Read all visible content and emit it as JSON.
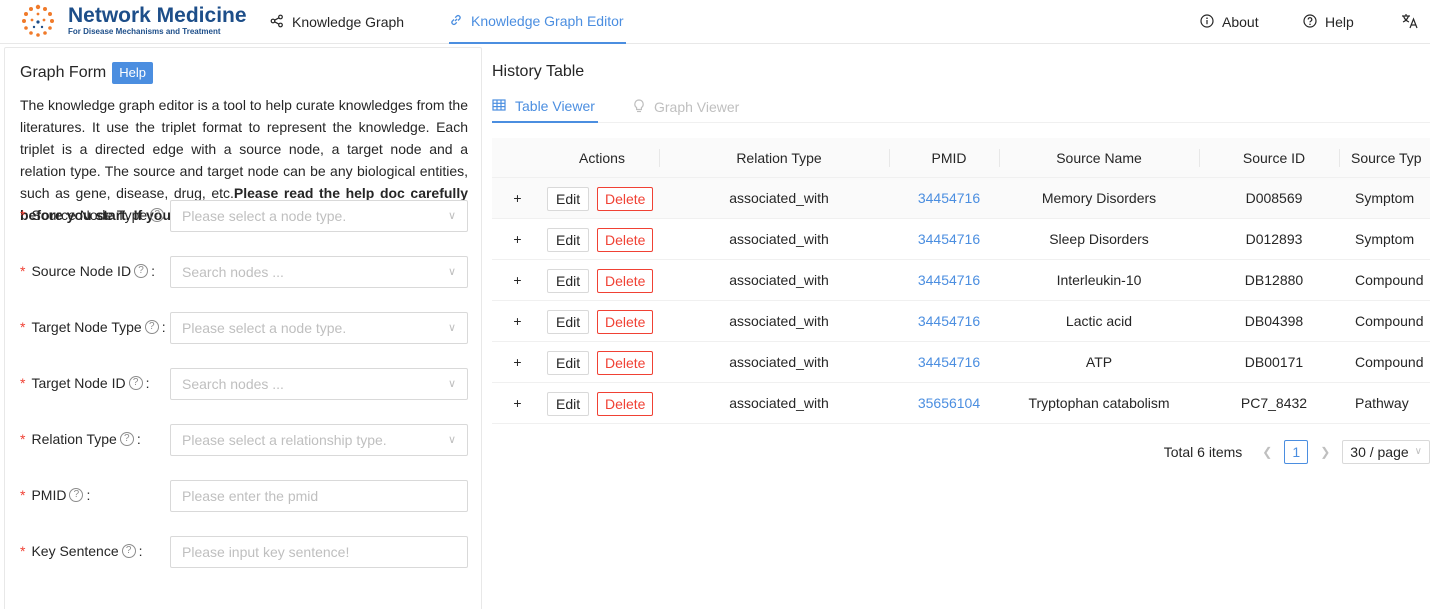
{
  "header": {
    "brand_title": "Network Medicine",
    "brand_subtitle": "For Disease Mechanisms and Treatment",
    "nav": [
      {
        "label": "Knowledge Graph",
        "icon": "share-icon"
      },
      {
        "label": "Knowledge Graph Editor",
        "icon": "link-icon",
        "active": true
      }
    ],
    "about_label": "About",
    "help_label": "Help",
    "language_icon": "translate-icon"
  },
  "form": {
    "title": "Graph Form",
    "help_button": "Help",
    "description_plain": "The knowledge graph editor is a tool to help curate knowledges from the literatures. It use the triplet format to represent the knowledge. Each triplet is a directed edge with a source node, a target node and a relation type. The source and target node can be any biological entities, such as gene, disease, drug, etc.",
    "description_bold": "Please read the help doc carefully before you start. If you have any questions, please contact us.",
    "fields": [
      {
        "label": "Source Node Type",
        "colon": "",
        "placeholder": "Please select a node type.",
        "kind": "select"
      },
      {
        "label": "Source Node ID",
        "colon": ":",
        "placeholder": "Search nodes ...",
        "kind": "select"
      },
      {
        "label": "Target Node Type",
        "colon": ":",
        "placeholder": "Please select a node type.",
        "kind": "select"
      },
      {
        "label": "Target Node ID",
        "colon": ":",
        "placeholder": "Search nodes ...",
        "kind": "select"
      },
      {
        "label": "Relation Type",
        "colon": ":",
        "placeholder": "Please select a relationship type.",
        "kind": "select"
      },
      {
        "label": "PMID",
        "colon": ":",
        "placeholder": "Please enter the pmid",
        "kind": "input"
      },
      {
        "label": "Key Sentence",
        "colon": ":",
        "placeholder": "Please input key sentence!",
        "kind": "input"
      }
    ]
  },
  "history": {
    "title": "History Table",
    "tabs": [
      {
        "label": "Table Viewer",
        "icon": "table-icon",
        "active": true
      },
      {
        "label": "Graph Viewer",
        "icon": "bulb-icon",
        "active": false
      }
    ],
    "columns": [
      "Actions",
      "Relation Type",
      "PMID",
      "Source Name",
      "Source ID",
      "Source Typ"
    ],
    "edit_label": "Edit",
    "delete_label": "Delete",
    "expand_label": "+",
    "rows": [
      {
        "relation": "associated_with",
        "pmid": "34454716",
        "source_name": "Memory Disorders",
        "source_id": "D008569",
        "source_type": "Symptom"
      },
      {
        "relation": "associated_with",
        "pmid": "34454716",
        "source_name": "Sleep Disorders",
        "source_id": "D012893",
        "source_type": "Symptom"
      },
      {
        "relation": "associated_with",
        "pmid": "34454716",
        "source_name": "Interleukin-10",
        "source_id": "DB12880",
        "source_type": "Compound"
      },
      {
        "relation": "associated_with",
        "pmid": "34454716",
        "source_name": "Lactic acid",
        "source_id": "DB04398",
        "source_type": "Compound"
      },
      {
        "relation": "associated_with",
        "pmid": "34454716",
        "source_name": "ATP",
        "source_id": "DB00171",
        "source_type": "Compound"
      },
      {
        "relation": "associated_with",
        "pmid": "35656104",
        "source_name": "Tryptophan catabolism",
        "source_id": "PC7_8432",
        "source_type": "Pathway"
      }
    ],
    "pagination": {
      "total_text": "Total 6 items",
      "current_page": "1",
      "page_size": "30 / page"
    }
  },
  "colors": {
    "accent": "#4b8ee0",
    "danger": "#f04134",
    "brand": "#1d4e89"
  }
}
